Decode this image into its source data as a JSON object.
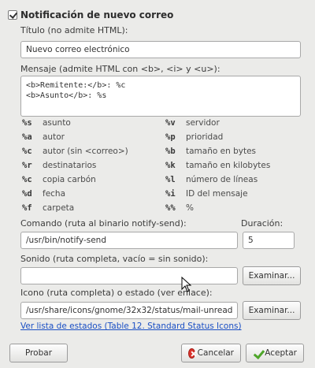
{
  "section": {
    "title": "Notificación de nuevo correo",
    "enabled": true
  },
  "title_field": {
    "label": "Título (no admite HTML):",
    "value": "Nuevo correo electrónico"
  },
  "message_field": {
    "label": "Mensaje (admite HTML con <b>, <i> y <u>):",
    "lines": [
      "<b>Remitente:</b>: %c",
      "<b>Asunto</b>: %s"
    ]
  },
  "legend": {
    "left": [
      {
        "code": "%s",
        "desc": "asunto"
      },
      {
        "code": "%a",
        "desc": "autor"
      },
      {
        "code": "%c",
        "desc": "autor (sin <correo>)"
      },
      {
        "code": "%r",
        "desc": "destinatarios"
      },
      {
        "code": "%c",
        "desc": "copia carbón"
      },
      {
        "code": "%d",
        "desc": "fecha"
      },
      {
        "code": "%f",
        "desc": "carpeta"
      }
    ],
    "right": [
      {
        "code": "%v",
        "desc": "servidor"
      },
      {
        "code": "%p",
        "desc": "prioridad"
      },
      {
        "code": "%b",
        "desc": "tamaño en bytes"
      },
      {
        "code": "%k",
        "desc": "tamaño en kilobytes"
      },
      {
        "code": "%l",
        "desc": "número de líneas"
      },
      {
        "code": "%i",
        "desc": "ID del mensaje"
      },
      {
        "code": "%%",
        "desc": "%"
      }
    ]
  },
  "command": {
    "label": "Comando (ruta al binario notify-send):",
    "value": "/usr/bin/notify-send"
  },
  "duration": {
    "label": "Duración:",
    "value": "5"
  },
  "sound": {
    "label": "Sonido (ruta completa, vacío = sin sonido):",
    "value": "",
    "browse_label": "Examinar..."
  },
  "icon": {
    "label": "Icono (ruta completa) o estado (ver enlace):",
    "value": "/usr/share/icons/gnome/32x32/status/mail-unread",
    "browse_label": "Examinar..."
  },
  "status_link": "Ver lista de estados (Table 12. Standard Status Icons)",
  "buttons": {
    "test": "Probar",
    "cancel": "Cancelar",
    "accept": "Aceptar"
  },
  "colors": {
    "background": "#ebebe9",
    "link": "#1a4fc4",
    "cancel_icon": "#d9322c",
    "accept_icon": "#4ea62a"
  }
}
